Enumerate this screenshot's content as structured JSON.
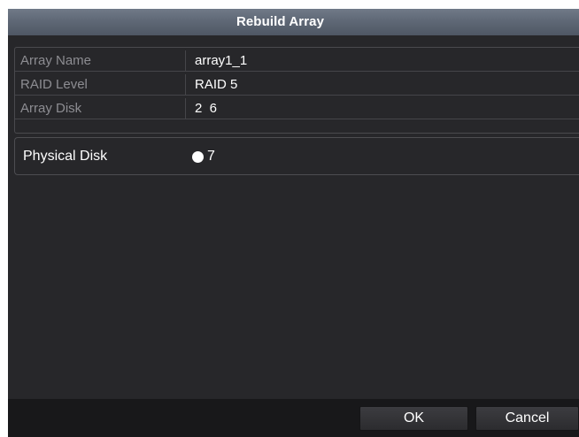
{
  "dialog": {
    "title": "Rebuild Array"
  },
  "array_info": {
    "rows": [
      {
        "label": "Array Name",
        "value": "array1_1"
      },
      {
        "label": "RAID Level",
        "value": "RAID 5"
      },
      {
        "label": "Array Disk",
        "value": "2  6"
      }
    ]
  },
  "physical_disk": {
    "label": "Physical Disk",
    "options": [
      {
        "label": "7",
        "selected": true
      }
    ]
  },
  "footer": {
    "ok_label": "OK",
    "cancel_label": "Cancel"
  },
  "colors": {
    "dialog_background": "#27272a",
    "titlebar": "#5f6876",
    "footer_background": "#18181a",
    "label_text": "#8d8d92",
    "value_text": "#ffffff"
  }
}
